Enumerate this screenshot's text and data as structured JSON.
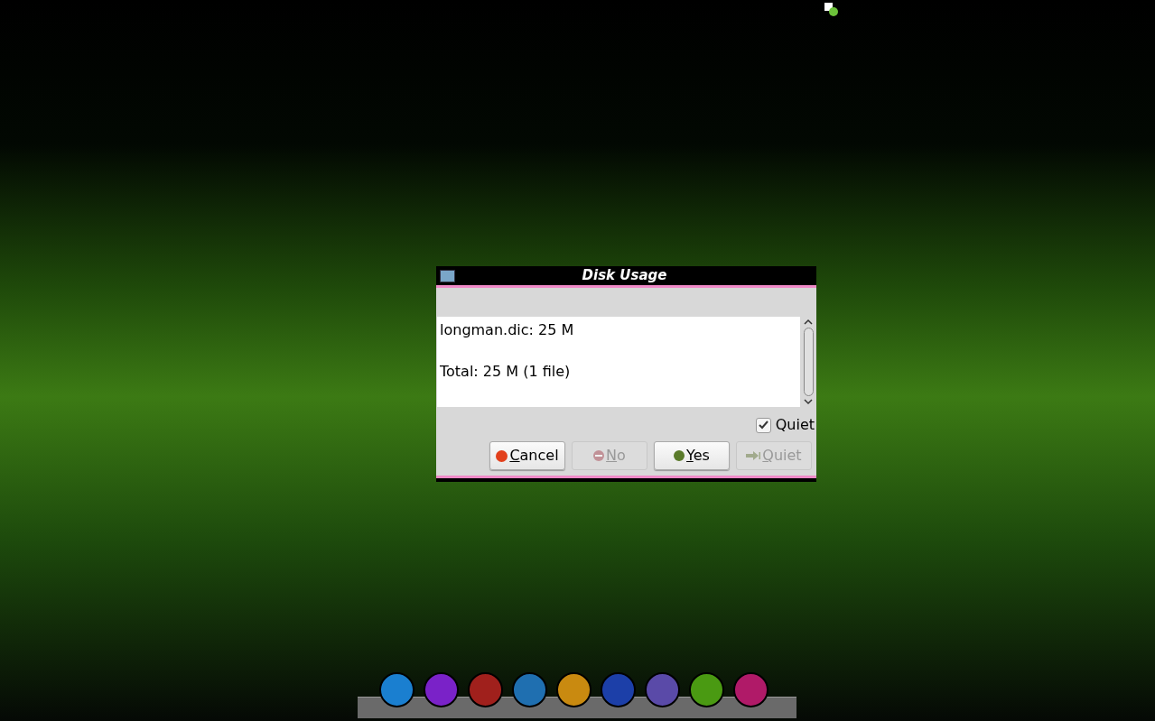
{
  "dialog": {
    "title": "Disk Usage",
    "lines": [
      "longman.dic: 25 M",
      "Total: 25 M (1 file)"
    ],
    "checkbox": {
      "label": "Quiet",
      "checked": true
    },
    "buttons": [
      {
        "label": "Cancel",
        "kind": "cancel",
        "disabled": false
      },
      {
        "label": "No",
        "kind": "no",
        "disabled": true
      },
      {
        "label": "Yes",
        "kind": "yes",
        "disabled": false
      },
      {
        "label": "Quiet",
        "kind": "quiet",
        "disabled": true
      }
    ]
  },
  "dock": {
    "items": [
      {
        "color": "#1a7fd0"
      },
      {
        "color": "#7a22c8"
      },
      {
        "color": "#a0201c"
      },
      {
        "color": "#1f6fb0"
      },
      {
        "color": "#c98a10"
      },
      {
        "color": "#1c3fa8"
      },
      {
        "color": "#5a4aa8"
      },
      {
        "color": "#4a9a12"
      },
      {
        "color": "#b01a68"
      }
    ]
  }
}
